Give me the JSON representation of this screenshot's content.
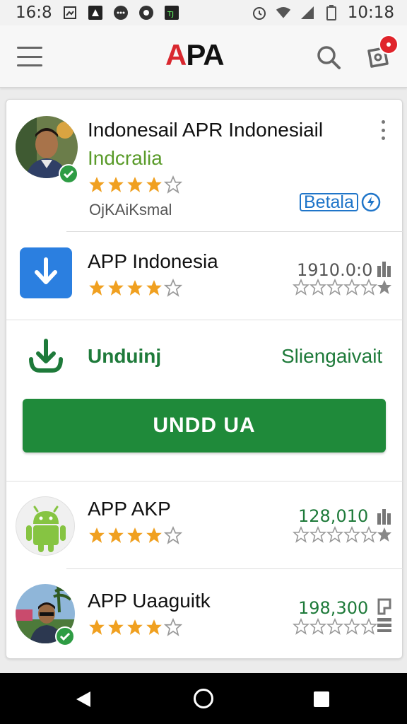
{
  "status_bar": {
    "left_time": "16:8",
    "right_time": "10:18",
    "icons": [
      "gallery-icon",
      "drive-icon",
      "chat-icon",
      "shield-icon",
      "app-icon",
      "alarm-icon",
      "wifi-icon",
      "signal-icon",
      "battery-icon"
    ]
  },
  "app_bar": {
    "logo_accent": "A",
    "logo_rest": "PA",
    "accent_color": "#d9282f"
  },
  "featured": {
    "title": "Indonesail APR Indonesiail",
    "subtitle": "Indcralia",
    "rating": 4,
    "meta": "OjKAiKsmal",
    "action_label": "Betala"
  },
  "download_item": {
    "title": "APP Indonesia",
    "rating": 4,
    "count": "1910.0:0"
  },
  "download_section": {
    "label": "Unduinj",
    "right_label": "Sliengaivait",
    "button_label": "UNDD UA",
    "button_color": "#1f8a3a"
  },
  "list": [
    {
      "title": "APP AKP",
      "rating": 4,
      "count": "128,010"
    },
    {
      "title": "APP Uaaguitk",
      "rating": 4,
      "count": "198,300"
    }
  ],
  "colors": {
    "star": "#f0a020",
    "green": "#1f8a3a",
    "blue": "#1f75c9"
  }
}
